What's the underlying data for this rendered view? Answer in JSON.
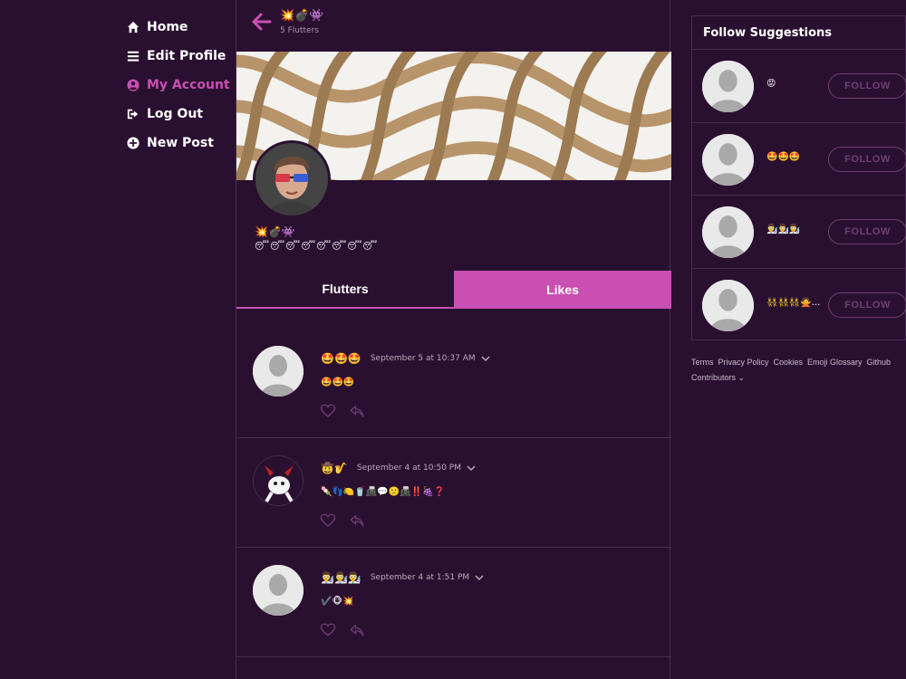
{
  "nav": {
    "items": [
      {
        "label": "Home",
        "icon": "home-icon"
      },
      {
        "label": "Edit Profile",
        "icon": "list-icon"
      },
      {
        "label": "My Account",
        "icon": "user-circle-icon",
        "active": true
      },
      {
        "label": "Log Out",
        "icon": "logout-icon"
      },
      {
        "label": "New Post",
        "icon": "plus-circle-icon"
      }
    ]
  },
  "profile": {
    "name": "💥💣👾",
    "flutter_count": "5 Flutters",
    "bio": "😴😴😴😴😴😴😴😴"
  },
  "tabs": [
    {
      "label": "Flutters"
    },
    {
      "label": "Likes",
      "active": true
    }
  ],
  "posts": [
    {
      "author": "🤩🤩🤩",
      "date": "September 5 at 10:37 AM",
      "body": "🤩🤩🤩"
    },
    {
      "author": "🤠🎷",
      "date": "September 4 at 10:50 PM",
      "body": "🍡👣🍋🥤📠💬🙁📠‼️🍇❓"
    },
    {
      "author": "👨‍🔬👨‍🔬👨‍🔬",
      "date": "September 4 at 1:51 PM",
      "body": "✔️🐵💥"
    }
  ],
  "suggestions": {
    "title": "Follow Suggestions",
    "follow_label": "FOLLOW",
    "users": [
      {
        "name": "😡"
      },
      {
        "name": "🤩🤩🤩"
      },
      {
        "name": "👨‍🔬👨‍🔬👨‍🔬"
      },
      {
        "name": "👯👯👯🙅..."
      }
    ]
  },
  "footer": {
    "links": [
      "Terms",
      "Privacy Policy",
      "Cookies",
      "Emoji Glossary",
      "Github"
    ],
    "contributors": "Contributors"
  },
  "colors": {
    "background": "#2a1030",
    "accent": "#c94fb2",
    "border": "#4a2a52",
    "follow_button": "#6e3f76"
  }
}
